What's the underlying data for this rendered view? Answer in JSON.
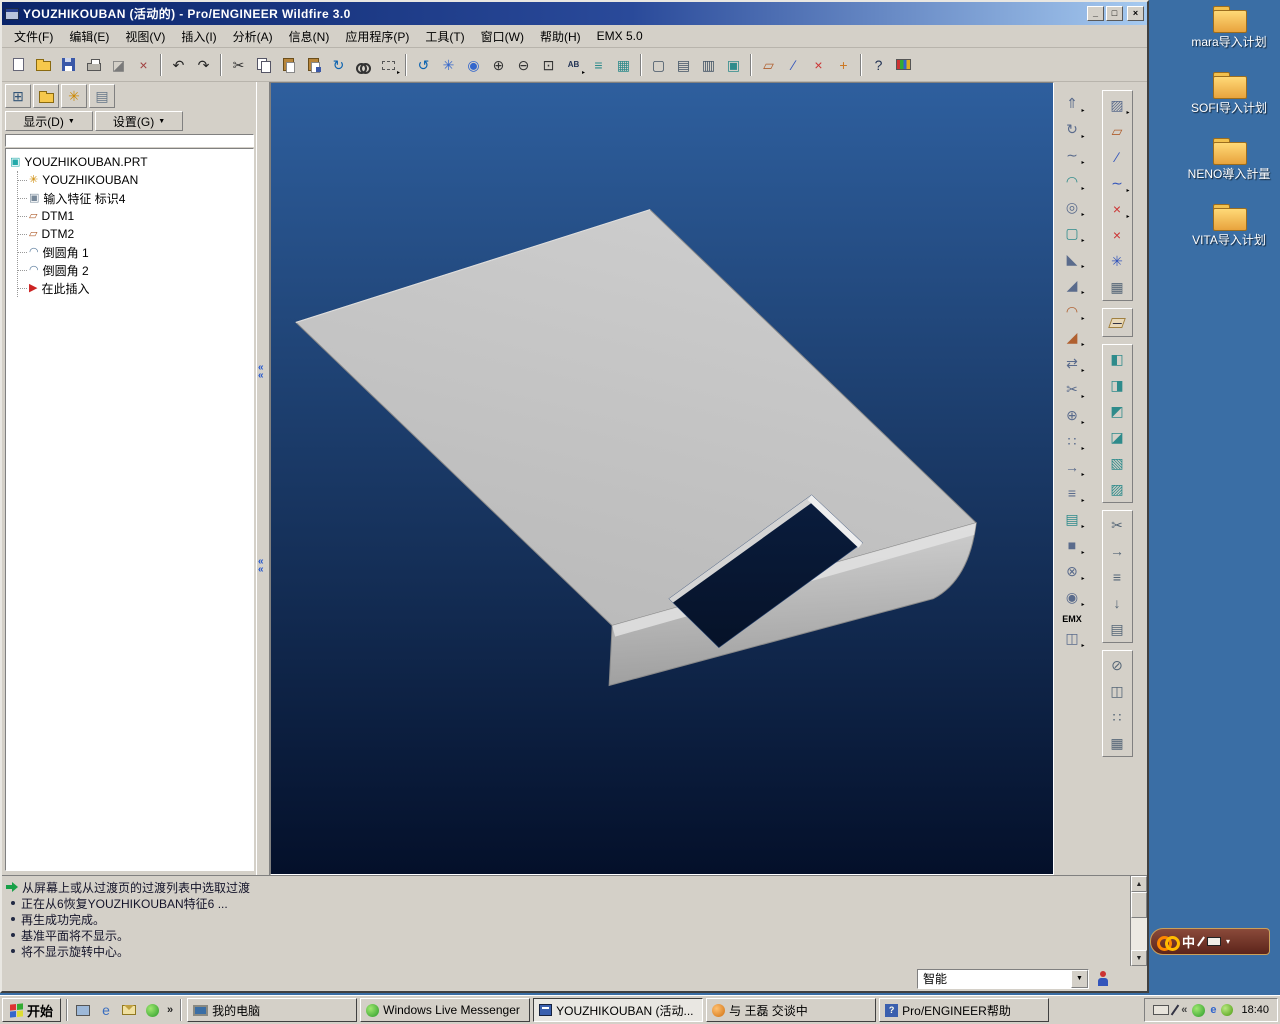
{
  "window": {
    "title": "YOUZHIKOUBAN (活动的) - Pro/ENGINEER Wildfire 3.0",
    "controls": [
      {
        "name": "minimize-button",
        "glyph": "_"
      },
      {
        "name": "restore-button",
        "glyph": "□"
      },
      {
        "name": "close-button",
        "glyph": "×"
      }
    ]
  },
  "menu_bar": [
    "文件(F)",
    "编辑(E)",
    "视图(V)",
    "插入(I)",
    "分析(A)",
    "信息(N)",
    "应用程序(P)",
    "工具(T)",
    "窗口(W)",
    "帮助(H)",
    "EMX 5.0"
  ],
  "toolbar": {
    "groups": [
      [
        {
          "n": "new-file-icon",
          "cls": "i-page"
        },
        {
          "n": "open-icon",
          "cls": "i-folder"
        },
        {
          "n": "save-icon",
          "cls": "i-floppy"
        },
        {
          "n": "print-icon",
          "cls": "i-printer"
        },
        {
          "n": "erase-icon",
          "g": "◪",
          "c": "#7a7a7a"
        },
        {
          "n": "delete-icon",
          "g": "×",
          "c": "#a04040"
        }
      ],
      [
        {
          "n": "undo-icon",
          "g": "↶",
          "c": "#222222"
        },
        {
          "n": "redo-icon",
          "g": "↷",
          "c": "#222222"
        }
      ],
      [
        {
          "n": "cut-icon",
          "g": "✂",
          "c": "#333333"
        },
        {
          "n": "copy-icon",
          "cls": "i-copy"
        },
        {
          "n": "paste-icon",
          "cls": "i-paste"
        },
        {
          "n": "paste-special-icon",
          "cls": "i-paste2"
        },
        {
          "n": "regenerate-icon",
          "g": "↻",
          "c": "#0a62b0"
        },
        {
          "n": "find-icon",
          "cls": "i-find"
        },
        {
          "n": "select-filter-icon",
          "cls": "i-selbox",
          "fly": 1
        }
      ],
      [
        {
          "n": "repaint-icon",
          "g": "↺",
          "c": "#0a62b0"
        },
        {
          "n": "spin-center-icon",
          "g": "✳",
          "c": "#3366cc"
        },
        {
          "n": "orient-mode-icon",
          "g": "◉",
          "c": "#3366cc"
        },
        {
          "n": "zoom-in-icon",
          "g": "⊕",
          "c": "#333333"
        },
        {
          "n": "zoom-out-icon",
          "g": "⊖",
          "c": "#333333"
        },
        {
          "n": "refit-icon",
          "g": "⊡",
          "c": "#333333"
        },
        {
          "n": "saved-orientations-icon",
          "g": "AB",
          "c": "#223355",
          "s": 1,
          "fly": 1
        },
        {
          "n": "layers-icon",
          "g": "≡",
          "c": "#2e8b8b"
        },
        {
          "n": "view-manager-icon",
          "g": "▦",
          "c": "#2e8b8b"
        }
      ],
      [
        {
          "n": "wireframe-icon",
          "g": "▢",
          "c": "#445566"
        },
        {
          "n": "hidden-line-icon",
          "g": "▤",
          "c": "#445566"
        },
        {
          "n": "no-hidden-icon",
          "g": "▥",
          "c": "#445566"
        },
        {
          "n": "shaded-icon",
          "g": "▣",
          "c": "#2e8b8b"
        }
      ],
      [
        {
          "n": "datum-planes-toggle-icon",
          "g": "▱",
          "c": "#b06030"
        },
        {
          "n": "datum-axes-toggle-icon",
          "g": "∕",
          "c": "#3355bb"
        },
        {
          "n": "datum-points-toggle-icon",
          "g": "×",
          "c": "#cc3333"
        },
        {
          "n": "csys-toggle-icon",
          "g": "+",
          "c": "#cc7722"
        }
      ],
      [
        {
          "n": "context-help-icon",
          "g": "?",
          "c": "#223355"
        },
        {
          "n": "appearances-icon",
          "cls": "i-palette"
        }
      ]
    ]
  },
  "tree_panel": {
    "display_label": "显示(D)",
    "settings_label": "设置(G)",
    "mini_toolbar": [
      {
        "n": "model-tree-toggle-icon",
        "g": "⊞",
        "c": "#335577"
      },
      {
        "n": "folder-browser-icon",
        "cls": "i-folder"
      },
      {
        "n": "favorites-icon",
        "g": "✳",
        "c": "#cc8800"
      },
      {
        "n": "connections-icon",
        "g": "▤",
        "c": "#667788"
      }
    ],
    "root": {
      "label": "YOUZHIKOUBAN.PRT",
      "icon": "part-icon",
      "g": "▣",
      "c": "#22aaaa"
    },
    "items": [
      {
        "label": "YOUZHIKOUBAN",
        "icon": "copied-geometry-icon",
        "g": "✳",
        "c": "#cc8800"
      },
      {
        "label": "输入特征 标识4",
        "icon": "import-feature-icon",
        "g": "▣",
        "c": "#778899"
      },
      {
        "label": "DTM1",
        "icon": "datum-plane-icon",
        "g": "▱",
        "c": "#b06030"
      },
      {
        "label": "DTM2",
        "icon": "datum-plane-icon",
        "g": "▱",
        "c": "#b06030"
      },
      {
        "label": "倒圆角 1",
        "icon": "round-feature-icon",
        "g": "◠",
        "c": "#557799"
      },
      {
        "label": "倒圆角 2",
        "icon": "round-feature-icon",
        "g": "◠",
        "c": "#557799"
      },
      {
        "label": "在此插入",
        "icon": "insert-here-icon",
        "g": "▶",
        "c": "#cc2222"
      }
    ]
  },
  "right_toolbar_1": [
    {
      "n": "extrude-tool-icon",
      "g": "⇑",
      "c": "#5a6b8c",
      "fly": 1
    },
    {
      "n": "revolve-tool-icon",
      "g": "↻",
      "c": "#5a6b8c",
      "fly": 1
    },
    {
      "n": "sweep-tool-icon",
      "g": "∼",
      "c": "#5a6b8c",
      "fly": 1
    },
    {
      "n": "boundary-blend-tool-icon",
      "g": "◠",
      "c": "#2e8b8b",
      "fly": 1
    },
    {
      "n": "hole-tool-icon",
      "g": "◎",
      "c": "#5a6b8c",
      "fly": 1
    },
    {
      "n": "shell-tool-icon",
      "g": "▢",
      "c": "#2e8b8b",
      "fly": 1
    },
    {
      "n": "rib-tool-icon",
      "g": "◣",
      "c": "#5a6b8c",
      "fly": 1
    },
    {
      "n": "draft-tool-icon",
      "g": "◢",
      "c": "#5a6b8c",
      "fly": 1
    },
    {
      "n": "round-tool-icon",
      "g": "◠",
      "c": "#b06030",
      "fly": 1
    },
    {
      "n": "chamfer-tool-icon",
      "g": "◢",
      "c": "#b06030",
      "fly": 1
    },
    {
      "n": "mirror-tool-icon",
      "g": "⇄",
      "c": "#5a6b8c",
      "fly": 1
    },
    {
      "n": "trim-tool-icon",
      "g": "✂",
      "c": "#5a6b8c",
      "fly": 1
    },
    {
      "n": "merge-tool-icon",
      "g": "⊕",
      "c": "#5a6b8c",
      "fly": 1
    },
    {
      "n": "pattern-tool-icon",
      "g": "∷",
      "c": "#5a6b8c",
      "fly": 1
    },
    {
      "n": "extend-tool-icon",
      "g": "→",
      "c": "#5a6b8c",
      "fly": 1
    },
    {
      "n": "offset-tool-icon",
      "g": "≡",
      "c": "#5a6b8c",
      "fly": 1
    },
    {
      "n": "thicken-tool-icon",
      "g": "▤",
      "c": "#2e8b8b",
      "fly": 1
    },
    {
      "n": "solidify-tool-icon",
      "g": "■",
      "c": "#5a6b8c",
      "fly": 1
    },
    {
      "n": "intersect-tool-icon",
      "g": "⊗",
      "c": "#5a6b8c",
      "fly": 1
    },
    {
      "n": "wrap-tool-icon",
      "g": "◉",
      "c": "#5a6b8c",
      "fly": 1
    }
  ],
  "right_toolbar_1_extra": {
    "label": "EMX",
    "icon": {
      "n": "emx-tool-icon",
      "g": "◫",
      "c": "#5a6b8c",
      "fly": 1
    }
  },
  "right_toolbar_2": {
    "groups": [
      [
        {
          "n": "sketched-datum-icon",
          "g": "▨",
          "c": "#5a6b8c",
          "fly": 1
        },
        {
          "n": "datum-plane-icon",
          "g": "▱",
          "c": "#b06030"
        },
        {
          "n": "datum-axis-icon",
          "g": "∕",
          "c": "#3355bb"
        },
        {
          "n": "datum-curve-icon",
          "g": "∼",
          "c": "#3355bb",
          "fly": 1
        },
        {
          "n": "datum-point-icon",
          "g": "×",
          "c": "#cc3333",
          "fly": 1
        },
        {
          "n": "datum-field-point-icon",
          "g": "×",
          "c": "#cc3333"
        },
        {
          "n": "datum-csys-icon",
          "g": "✳",
          "c": "#3355bb"
        },
        {
          "n": "datum-graph-icon",
          "g": "▦",
          "c": "#556677"
        }
      ],
      [
        {
          "n": "sketch-tool-icon",
          "cls": "i-sketch"
        }
      ],
      [
        {
          "n": "extrude-surface-icon",
          "g": "◧",
          "c": "#2e8b8b"
        },
        {
          "n": "revolve-surface-icon",
          "g": "◨",
          "c": "#2e8b8b"
        },
        {
          "n": "sweep-surface-icon",
          "g": "◩",
          "c": "#2e8b8b"
        },
        {
          "n": "blend-surface-icon",
          "g": "◪",
          "c": "#2e8b8b"
        },
        {
          "n": "offset-surface-icon",
          "g": "▧",
          "c": "#2e8b8b"
        },
        {
          "n": "copy-surface-icon",
          "g": "▨",
          "c": "#2e8b8b"
        }
      ],
      [
        {
          "n": "trim-surface-icon",
          "g": "✂",
          "c": "#556677"
        },
        {
          "n": "extend-surface-icon",
          "g": "→",
          "c": "#556677"
        },
        {
          "n": "offset-edge-icon",
          "g": "≡",
          "c": "#556677"
        },
        {
          "n": "project-curve-icon",
          "g": "↓",
          "c": "#556677"
        },
        {
          "n": "thicken-surface-icon",
          "g": "▤",
          "c": "#556677"
        }
      ],
      [
        {
          "n": "section-view-icon",
          "g": "⊘",
          "c": "#556677"
        },
        {
          "n": "zone-clip-icon",
          "g": "◫",
          "c": "#556677"
        },
        {
          "n": "component-display-icon",
          "g": "∷",
          "c": "#556677"
        },
        {
          "n": "calculator-icon",
          "g": "▦",
          "c": "#556677"
        }
      ]
    ]
  },
  "messages": [
    {
      "type": "prompt",
      "text": "从屏幕上或从过渡页的过渡列表中选取过渡"
    },
    {
      "type": "info",
      "text": "正在从6恢复YOUZHIKOUBAN特征6 ..."
    },
    {
      "type": "info",
      "text": "再生成功完成。"
    },
    {
      "type": "info",
      "text": "基准平面将不显示。"
    },
    {
      "type": "info",
      "text": "将不显示旋转中心。"
    }
  ],
  "status_bar": {
    "selector_label": "智能"
  },
  "taskbar": {
    "start_label": "开始",
    "overflow_glyph": "»",
    "quick_launch": [
      {
        "n": "show-desktop-icon",
        "cls": "i-qdesk"
      },
      {
        "n": "ie-launch-icon",
        "g": "e",
        "c": "#3a6ec0"
      },
      {
        "n": "mail-launch-icon",
        "cls": "i-qmail"
      },
      {
        "n": "messenger-launch-icon",
        "cls": "i-msn"
      }
    ],
    "tasks": [
      {
        "label": "我的电脑",
        "icon": "my-computer-icon",
        "cls": "i-computer",
        "active": false
      },
      {
        "label": "Windows Live Messenger",
        "icon": "messenger-icon",
        "cls": "i-msn",
        "active": false
      },
      {
        "label": "YOUZHIKOUBAN (活动...",
        "icon": "proe-window-icon",
        "cls": "i-proe",
        "active": true
      },
      {
        "label": "与 王磊 交谈中",
        "icon": "chat-icon",
        "cls": "i-msn2",
        "active": false
      },
      {
        "label": "Pro/ENGINEER帮助",
        "icon": "help-icon",
        "cls": "i-helpbook",
        "g": "?",
        "active": false
      }
    ],
    "tray": [
      {
        "n": "keyboard-tray-icon",
        "cls": "i-kbd"
      },
      {
        "n": "pen-tray-icon",
        "cls": "i-pen"
      },
      {
        "n": "tray-chevron-icon",
        "g": "«",
        "c": "#444444"
      },
      {
        "n": "messenger-tray-icon",
        "cls": "i-msn"
      },
      {
        "n": "ie-tray-icon",
        "g": "e",
        "c": "#3366cc"
      },
      {
        "n": "security-tray-icon",
        "cls": "i-shield"
      }
    ],
    "clock": "18:40"
  },
  "desktop": {
    "folders": [
      "mara导入计划",
      "SOFI导入计划",
      "NENO導入計量",
      "VITA导入计划"
    ]
  },
  "language_bar": {
    "label": "中"
  }
}
